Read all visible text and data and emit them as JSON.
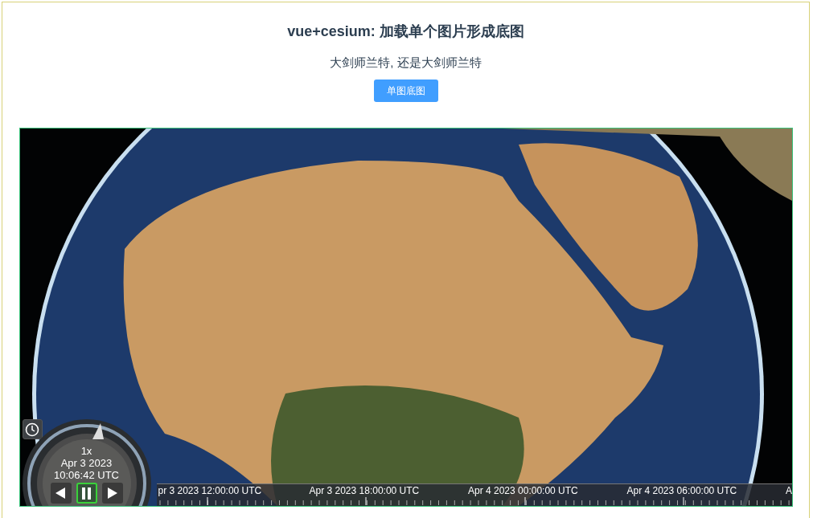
{
  "title": "vue+cesium: 加载单个图片形成底图",
  "subtitle": "大剑师兰特, 还是大剑师兰特",
  "button": "单图底图",
  "viewer": {
    "animation": {
      "speed": "1x",
      "date": "Apr 3 2023",
      "time": "10:06:42 UTC",
      "controls": [
        {
          "kind": "reverse",
          "selected": false
        },
        {
          "kind": "pause",
          "selected": true
        },
        {
          "kind": "play",
          "selected": false
        }
      ]
    },
    "timeline": {
      "labels": [
        "pr 3 2023 12:00:00 UTC",
        "Apr 3 2023 18:00:00 UTC",
        "Apr 4 2023 00:00:00 UTC",
        "Apr 4 2023 06:00:00 UTC",
        "A"
      ]
    }
  }
}
